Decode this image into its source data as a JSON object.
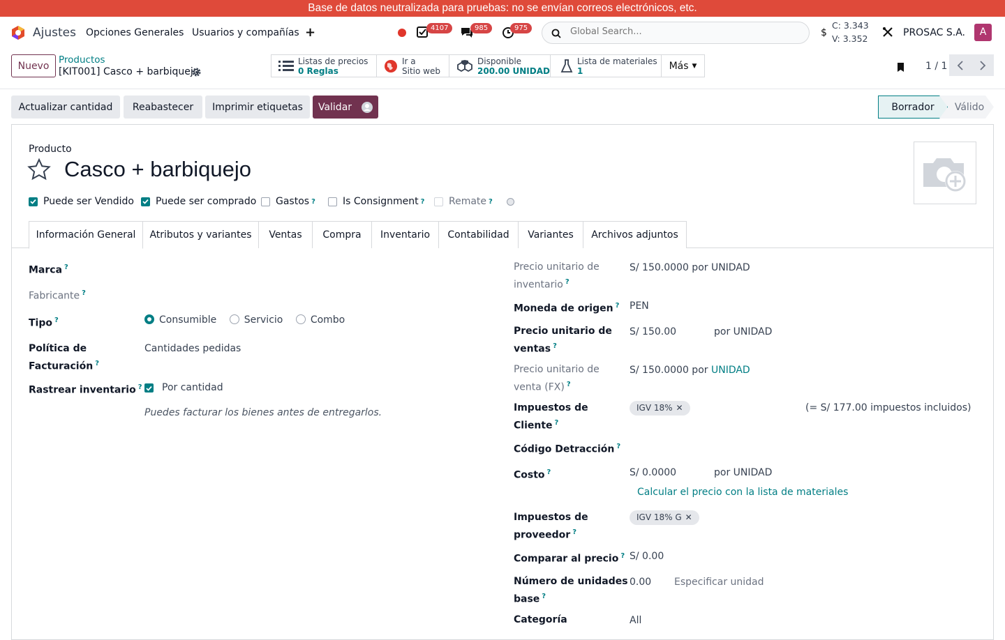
{
  "banner": "Base de datos neutralizada para pruebas: no se envían correos electrónicos, etc.",
  "navbar": {
    "app": "Ajustes",
    "menus": [
      "Opciones Generales",
      "Usuarios y compañías"
    ],
    "badges": {
      "activities": "4107",
      "messages": "985",
      "timers": "975"
    },
    "search_placeholder": "Global Search...",
    "currency_symbol": "$",
    "c_value": "C: 3.343",
    "v_value": "V: 3.352",
    "company": "PROSAC S.A.",
    "avatar": "A"
  },
  "control": {
    "new_button": "Nuevo",
    "breadcrumb_parent": "Productos",
    "breadcrumb_current": "[KIT001] Casco + barbiquejo",
    "smart_buttons": [
      {
        "label": "Listas de precios",
        "value": "0  Reglas"
      },
      {
        "label": "Ir a",
        "value": "Sitio web"
      },
      {
        "label": "Disponible",
        "value": "200.00 UNIDAD"
      },
      {
        "label": "Lista de materiales",
        "value": "1"
      }
    ],
    "more": "Más",
    "pager": "1 / 1"
  },
  "actions": {
    "update_qty": "Actualizar cantidad",
    "replenish": "Reabastecer",
    "print_labels": "Imprimir etiquetas",
    "validate": "Validar",
    "status_draft": "Borrador",
    "status_valid": "Válido"
  },
  "form": {
    "kind_label": "Producto",
    "name": "Casco + barbiquejo",
    "checkboxes": [
      {
        "label": "Puede ser Vendido",
        "checked": true
      },
      {
        "label": "Puede ser comprado",
        "checked": true
      },
      {
        "label": "Gastos",
        "checked": false
      },
      {
        "label": "Is Consignment",
        "checked": false
      },
      {
        "label": "Remate",
        "checked": false
      }
    ],
    "tabs": [
      "Información General",
      "Atributos y variantes",
      "Ventas",
      "Compra",
      "Inventario",
      "Contabilidad",
      "Variantes",
      "Archivos adjuntos"
    ],
    "left": {
      "marca": "Marca",
      "fabricante": "Fabricante",
      "tipo": "Tipo",
      "tipo_options": [
        "Consumible",
        "Servicio",
        "Combo"
      ],
      "politica_l1": "Política de",
      "politica_l2": "Facturación",
      "politica_value": "Cantidades pedidas",
      "rastrear": "Rastrear inventario",
      "rastrear_value": "Por cantidad",
      "hint": "Puedes facturar los bienes antes de entregarlos."
    },
    "right": {
      "pui_l1": "Precio unitario de",
      "pui_l2": "inventario",
      "pui_value": "S/ 150.0000 por UNIDAD",
      "moneda": "Moneda de origen",
      "moneda_value": "PEN",
      "puv_l1": "Precio unitario de",
      "puv_l2": "ventas",
      "puv_value": "S/ 150.00",
      "puv_unit": "por UNIDAD",
      "pufx_l1": "Precio unitario de",
      "pufx_l2": "venta (FX)",
      "pufx_value": "S/ 150.0000 por ",
      "pufx_unit": "UNIDAD",
      "imp_cli_l1": "Impuestos de",
      "imp_cli_l2": "Cliente",
      "imp_cli_tag": "IGV 18%",
      "imp_cli_note": "(= S/ 177.00 impuestos incluidos)",
      "detraccion": "Código Detracción",
      "costo": "Costo",
      "costo_value": "S/ 0.0000",
      "costo_unit": "por UNIDAD",
      "calc_link": "Calcular el precio con la lista de materiales",
      "imp_prov_l1": "Impuestos de",
      "imp_prov_l2": "proveedor",
      "imp_prov_tag": "IGV 18% G",
      "comparar": "Comparar al precio",
      "comparar_value": "S/ 0.00",
      "nub_l1": "Número de unidades",
      "nub_l2": "base",
      "nub_value": "0.00",
      "nub_unit": "Especificar unidad",
      "categoria": "Categoría",
      "categoria_value": "All"
    }
  }
}
